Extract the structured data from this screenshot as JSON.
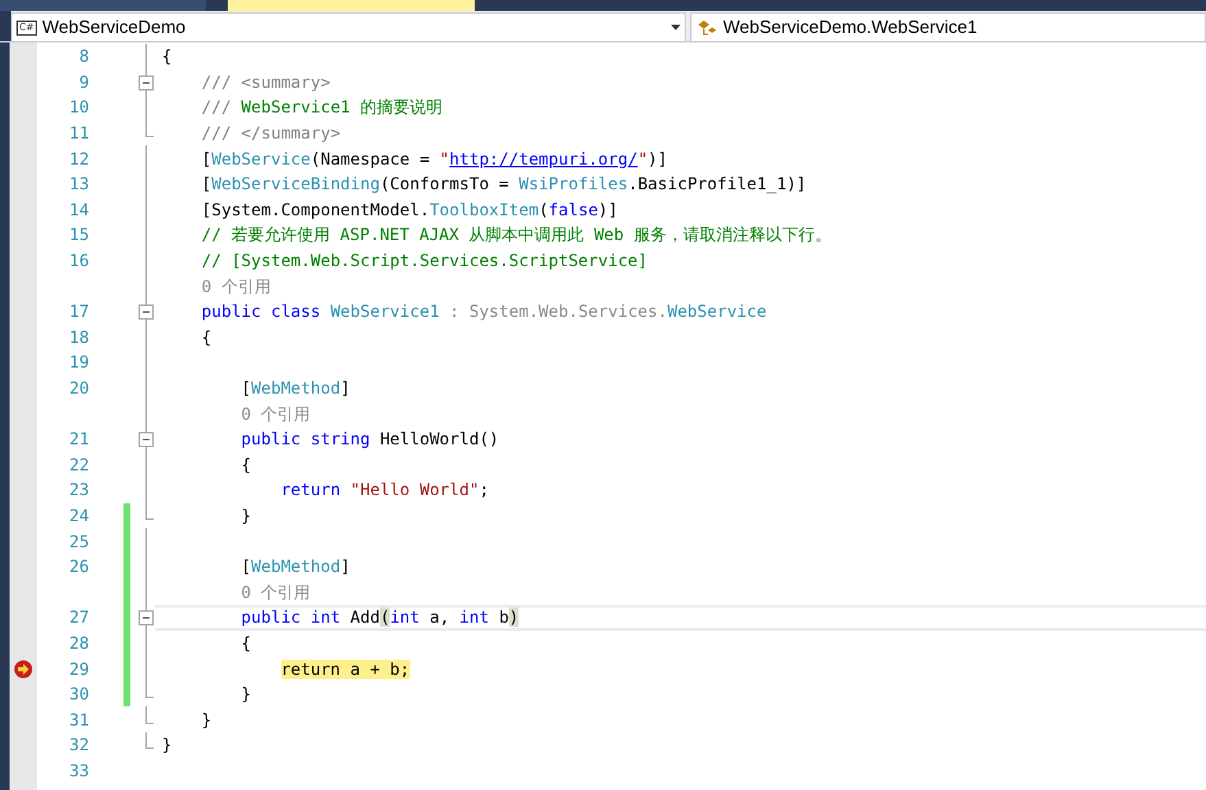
{
  "navigation_bar": {
    "project_dropdown": {
      "icon_label": "C#",
      "value": "WebServiceDemo"
    },
    "member_dropdown": {
      "value": "WebServiceDemo.WebService1"
    }
  },
  "editor": {
    "lines": [
      {
        "number": "8",
        "kind": "code",
        "foldable": false,
        "block_end": false,
        "changed": false,
        "current": false,
        "breakpoint": false,
        "tokens": [
          {
            "text": "{",
            "kind": "plain"
          }
        ]
      },
      {
        "number": "9",
        "kind": "code",
        "foldable": true,
        "block_end": false,
        "changed": false,
        "current": false,
        "breakpoint": false,
        "tokens": [
          {
            "text": "    /// <summary>",
            "kind": "xmldoc"
          }
        ]
      },
      {
        "number": "10",
        "kind": "code",
        "foldable": false,
        "block_end": false,
        "changed": false,
        "current": false,
        "breakpoint": false,
        "tokens": [
          {
            "text": "    /// ",
            "kind": "xmldoc"
          },
          {
            "text": "WebService1 的摘要说明",
            "kind": "comment"
          }
        ]
      },
      {
        "number": "11",
        "kind": "code",
        "foldable": false,
        "block_end": true,
        "changed": false,
        "current": false,
        "breakpoint": false,
        "tokens": [
          {
            "text": "    /// </summary>",
            "kind": "xmldoc"
          }
        ]
      },
      {
        "number": "12",
        "kind": "code",
        "foldable": false,
        "block_end": false,
        "changed": false,
        "current": false,
        "breakpoint": false,
        "tokens": [
          {
            "text": "    [",
            "kind": "plain"
          },
          {
            "text": "WebService",
            "kind": "type"
          },
          {
            "text": "(Namespace = ",
            "kind": "plain"
          },
          {
            "text": "\"",
            "kind": "string"
          },
          {
            "text": "http://tempuri.org/",
            "kind": "link"
          },
          {
            "text": "\"",
            "kind": "string"
          },
          {
            "text": ")]",
            "kind": "plain"
          }
        ]
      },
      {
        "number": "13",
        "kind": "code",
        "foldable": false,
        "block_end": false,
        "changed": false,
        "current": false,
        "breakpoint": false,
        "tokens": [
          {
            "text": "    [",
            "kind": "plain"
          },
          {
            "text": "WebServiceBinding",
            "kind": "type"
          },
          {
            "text": "(ConformsTo = ",
            "kind": "plain"
          },
          {
            "text": "WsiProfiles",
            "kind": "type"
          },
          {
            "text": ".BasicProfile1_1)]",
            "kind": "plain"
          }
        ]
      },
      {
        "number": "14",
        "kind": "code",
        "foldable": false,
        "block_end": false,
        "changed": false,
        "current": false,
        "breakpoint": false,
        "tokens": [
          {
            "text": "    [System.ComponentModel.",
            "kind": "plain"
          },
          {
            "text": "ToolboxItem",
            "kind": "type"
          },
          {
            "text": "(",
            "kind": "plain"
          },
          {
            "text": "false",
            "kind": "keyword"
          },
          {
            "text": ")]",
            "kind": "plain"
          }
        ]
      },
      {
        "number": "15",
        "kind": "code",
        "foldable": false,
        "block_end": false,
        "changed": false,
        "current": false,
        "breakpoint": false,
        "tokens": [
          {
            "text": "    // 若要允许使用 ASP.NET AJAX 从脚本中调用此 Web 服务，请取消注释以下行。",
            "kind": "comment"
          }
        ]
      },
      {
        "number": "16",
        "kind": "code",
        "foldable": false,
        "block_end": false,
        "changed": false,
        "current": false,
        "breakpoint": false,
        "tokens": [
          {
            "text": "    // [System.Web.Script.Services.ScriptService]",
            "kind": "comment"
          }
        ]
      },
      {
        "kind": "codelens",
        "changed": false,
        "text": "    0 个引用"
      },
      {
        "number": "17",
        "kind": "code",
        "foldable": true,
        "block_end": false,
        "changed": false,
        "current": false,
        "breakpoint": false,
        "tokens": [
          {
            "text": "    public class ",
            "kind": "keyword"
          },
          {
            "text": "WebService1",
            "kind": "type"
          },
          {
            "text": " : System.Web.Services.",
            "kind": "inherit"
          },
          {
            "text": "WebService",
            "kind": "type"
          }
        ]
      },
      {
        "number": "18",
        "kind": "code",
        "foldable": false,
        "block_end": false,
        "changed": false,
        "current": false,
        "breakpoint": false,
        "tokens": [
          {
            "text": "    {",
            "kind": "plain"
          }
        ]
      },
      {
        "number": "19",
        "kind": "code",
        "foldable": false,
        "block_end": false,
        "changed": false,
        "current": false,
        "breakpoint": false
      },
      {
        "number": "20",
        "kind": "code",
        "foldable": false,
        "block_end": false,
        "changed": false,
        "current": false,
        "breakpoint": false,
        "tokens": [
          {
            "text": "        [",
            "kind": "plain"
          },
          {
            "text": "WebMethod",
            "kind": "type"
          },
          {
            "text": "]",
            "kind": "plain"
          }
        ]
      },
      {
        "kind": "codelens",
        "changed": false,
        "text": "        0 个引用"
      },
      {
        "number": "21",
        "kind": "code",
        "foldable": true,
        "block_end": false,
        "changed": false,
        "current": false,
        "breakpoint": false,
        "tokens": [
          {
            "text": "        public string",
            "kind": "keyword"
          },
          {
            "text": " HelloWorld()",
            "kind": "plain"
          }
        ]
      },
      {
        "number": "22",
        "kind": "code",
        "foldable": false,
        "block_end": false,
        "changed": false,
        "current": false,
        "breakpoint": false,
        "tokens": [
          {
            "text": "        {",
            "kind": "plain"
          }
        ]
      },
      {
        "number": "23",
        "kind": "code",
        "foldable": false,
        "block_end": false,
        "changed": false,
        "current": false,
        "breakpoint": false,
        "tokens": [
          {
            "text": "            return ",
            "kind": "keyword"
          },
          {
            "text": "\"Hello World\"",
            "kind": "string"
          },
          {
            "text": ";",
            "kind": "plain"
          }
        ]
      },
      {
        "number": "24",
        "kind": "code",
        "foldable": false,
        "block_end": true,
        "changed": true,
        "current": false,
        "breakpoint": false,
        "tokens": [
          {
            "text": "        }",
            "kind": "plain"
          }
        ]
      },
      {
        "number": "25",
        "kind": "code",
        "foldable": false,
        "block_end": false,
        "changed": true,
        "current": false,
        "breakpoint": false
      },
      {
        "number": "26",
        "kind": "code",
        "foldable": false,
        "block_end": false,
        "changed": true,
        "current": false,
        "breakpoint": false,
        "tokens": [
          {
            "text": "        [",
            "kind": "plain"
          },
          {
            "text": "WebMethod",
            "kind": "type"
          },
          {
            "text": "]",
            "kind": "plain"
          }
        ]
      },
      {
        "kind": "codelens",
        "changed": true,
        "text": "        0 个引用"
      },
      {
        "number": "27",
        "kind": "code",
        "foldable": true,
        "block_end": false,
        "changed": true,
        "current": true,
        "breakpoint": false,
        "tokens": [
          {
            "text": "        public int",
            "kind": "keyword"
          },
          {
            "text": " Add",
            "kind": "plain"
          },
          {
            "text": "(",
            "kind": "brace_match"
          },
          {
            "text": "int",
            "kind": "keyword"
          },
          {
            "text": " a, ",
            "kind": "plain"
          },
          {
            "text": "int",
            "kind": "keyword"
          },
          {
            "text": " b",
            "kind": "plain"
          },
          {
            "text": ")",
            "kind": "brace_match"
          }
        ]
      },
      {
        "number": "28",
        "kind": "code",
        "foldable": false,
        "block_end": false,
        "changed": true,
        "current": false,
        "breakpoint": false,
        "tokens": [
          {
            "text": "        {",
            "kind": "plain"
          }
        ]
      },
      {
        "number": "29",
        "kind": "code",
        "foldable": false,
        "block_end": false,
        "changed": true,
        "current": false,
        "breakpoint": true,
        "tokens": [
          {
            "text": "return a + b;",
            "kind": "executing"
          }
        ]
      },
      {
        "number": "30",
        "kind": "code",
        "foldable": false,
        "block_end": true,
        "changed": true,
        "current": false,
        "breakpoint": false,
        "tokens": [
          {
            "text": "        }",
            "kind": "plain"
          }
        ]
      },
      {
        "number": "31",
        "kind": "code",
        "foldable": false,
        "block_end": true,
        "changed": false,
        "current": false,
        "breakpoint": false,
        "tokens": [
          {
            "text": "    }",
            "kind": "plain"
          }
        ]
      },
      {
        "number": "32",
        "kind": "code",
        "foldable": false,
        "block_end": true,
        "changed": false,
        "current": false,
        "breakpoint": false,
        "tokens": [
          {
            "text": "}",
            "kind": "plain"
          }
        ]
      },
      {
        "number": "33",
        "kind": "code",
        "foldable": false,
        "block_end": false,
        "changed": false,
        "current": false,
        "breakpoint": false
      }
    ]
  }
}
